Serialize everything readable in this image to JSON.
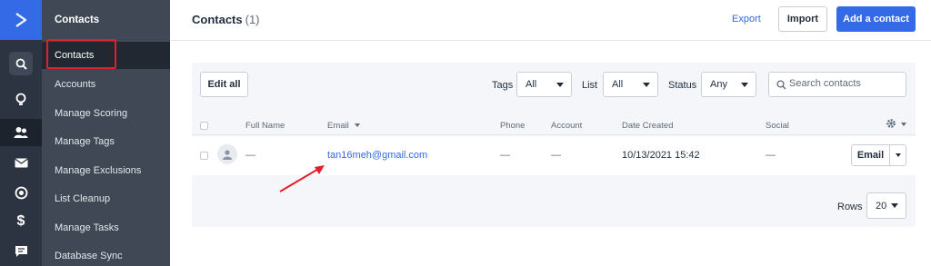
{
  "colors": {
    "brand_blue": "#356ae6",
    "annotation_red": "#e0212b",
    "rail_bg": "#2c3441",
    "subnav_bg": "#404855"
  },
  "rail": {
    "icons": [
      "logo-chevron-icon",
      "search-icon",
      "lightbulb-icon",
      "contacts-icon",
      "envelope-icon",
      "target-icon",
      "dollar-icon",
      "chat-icon"
    ]
  },
  "subnav": {
    "header": "Contacts",
    "items": [
      {
        "label": "Contacts"
      },
      {
        "label": "Accounts"
      },
      {
        "label": "Manage Scoring"
      },
      {
        "label": "Manage Tags"
      },
      {
        "label": "Manage Exclusions"
      },
      {
        "label": "List Cleanup"
      },
      {
        "label": "Manage Tasks"
      },
      {
        "label": "Database Sync"
      }
    ]
  },
  "header": {
    "title": "Contacts",
    "count": "(1)",
    "export_label": "Export",
    "import_label": "Import",
    "add_label": "Add a contact"
  },
  "filters": {
    "edit_all_label": "Edit all",
    "tags": {
      "label": "Tags",
      "value": "All"
    },
    "list": {
      "label": "List",
      "value": "All"
    },
    "status": {
      "label": "Status",
      "value": "Any"
    },
    "search_placeholder": "Search contacts"
  },
  "table": {
    "columns": {
      "full_name": "Full Name",
      "email": "Email",
      "phone": "Phone",
      "account": "Account",
      "date_created": "Date Created",
      "social": "Social"
    },
    "rows": [
      {
        "full_name": "—",
        "email": "tan16meh@gmail.com",
        "phone": "—",
        "account": "—",
        "date_created": "10/13/2021 15:42",
        "social": "—",
        "action_label": "Email"
      }
    ]
  },
  "pagination": {
    "rows_label": "Rows",
    "rows_value": "20"
  }
}
